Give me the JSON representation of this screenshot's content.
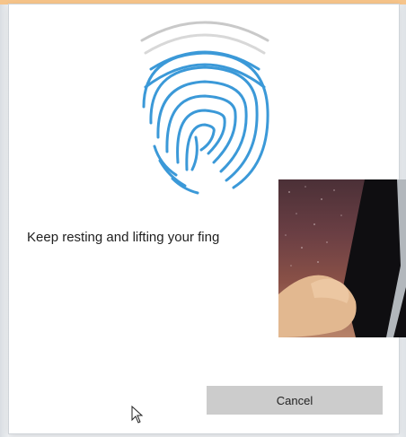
{
  "dialog": {
    "instruction": "Keep resting and lifting your fing",
    "cancel_label": "Cancel"
  },
  "icons": {
    "fingerprint": "fingerprint-icon",
    "cursor": "mouse-cursor-icon"
  },
  "colors": {
    "accent": "#3b99d8",
    "top_strip": "#f6c48a",
    "button_bg": "#cccccc"
  }
}
